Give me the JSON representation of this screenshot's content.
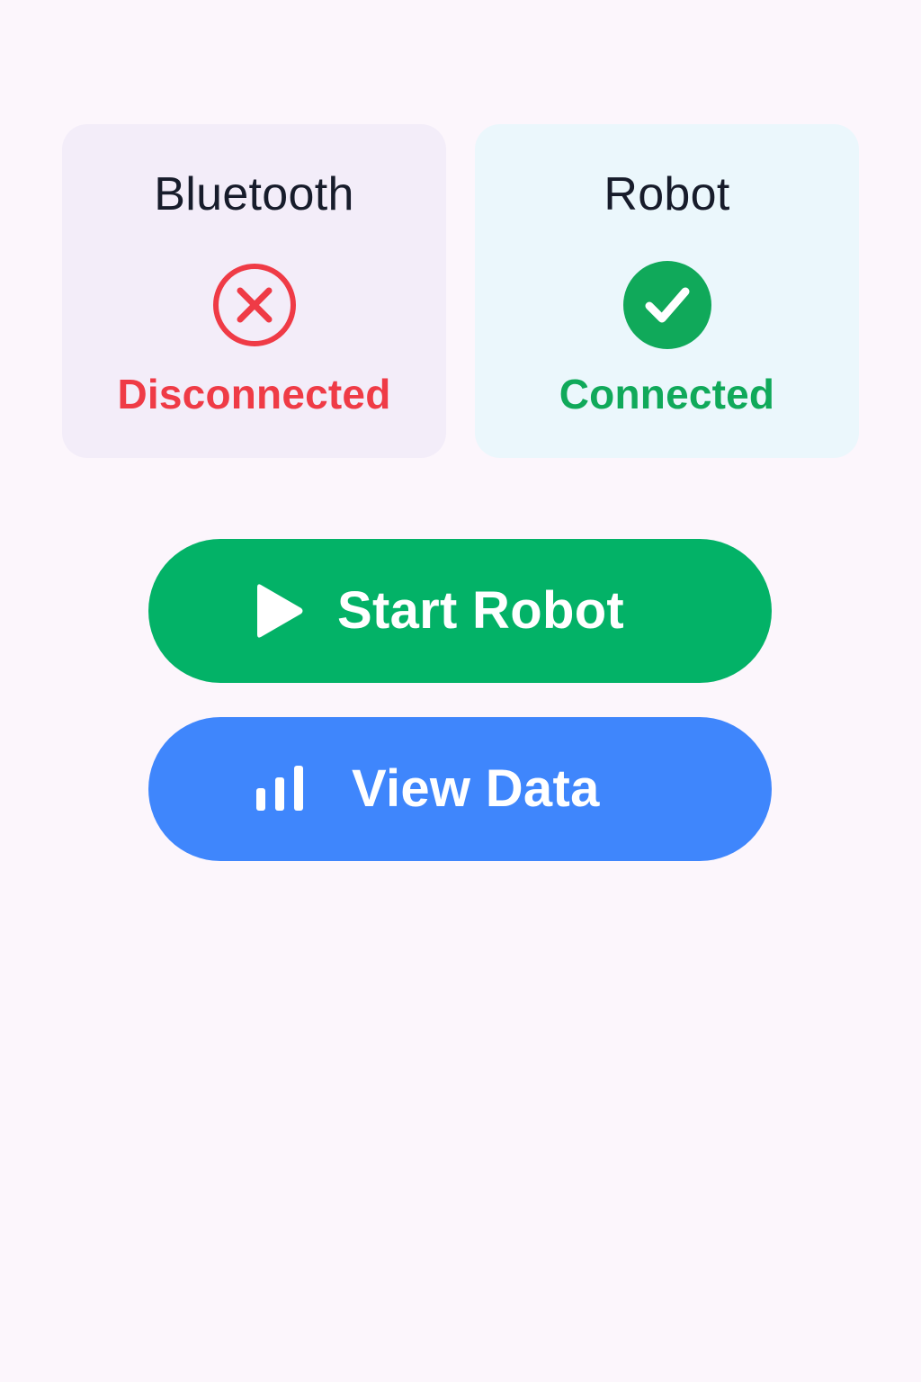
{
  "colors": {
    "background": "#fcf6fc",
    "bluetooth_card_bg": "#f3edf9",
    "robot_card_bg": "#ebf7fc",
    "title_text": "#171c2b",
    "error": "#ef3b46",
    "success": "#10a95a",
    "start_button": "#03b267",
    "view_data_button": "#3f86fc"
  },
  "status_cards": {
    "bluetooth": {
      "title": "Bluetooth",
      "status": "Disconnected",
      "icon": "x-circle-icon"
    },
    "robot": {
      "title": "Robot",
      "status": "Connected",
      "icon": "check-circle-icon"
    }
  },
  "actions": {
    "start_robot": {
      "label": "Start Robot",
      "icon": "play-icon"
    },
    "view_data": {
      "label": "View Data",
      "icon": "bar-chart-icon"
    }
  }
}
